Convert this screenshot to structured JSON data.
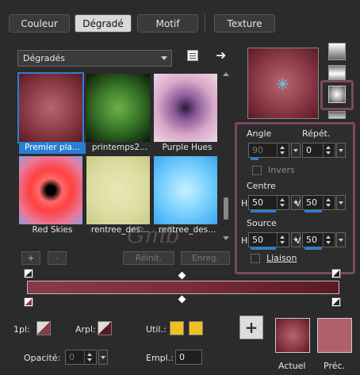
{
  "tabs": [
    {
      "label": "Couleur",
      "active": false
    },
    {
      "label": "Dégradé",
      "active": true
    },
    {
      "label": "Motif",
      "active": false
    },
    {
      "label": "Texture",
      "active": false
    }
  ],
  "gradients_dropdown": {
    "value": "Dégradés"
  },
  "thumbnails": [
    {
      "label": "Premier pla...",
      "selected": true
    },
    {
      "label": "printemps2...",
      "selected": false
    },
    {
      "label": "Purple Hues",
      "selected": false
    },
    {
      "label": "Red Skies",
      "selected": false
    },
    {
      "label": "rentree_des...",
      "selected": false
    },
    {
      "label": "rentree_des...",
      "selected": false
    }
  ],
  "buttons": {
    "add": "+",
    "remove": "-",
    "reset": "Réinit.",
    "save": "Enreg."
  },
  "options": {
    "angle_label": "Angle",
    "angle_value": "90",
    "repeat_label": "Répét.",
    "repeat_value": "0",
    "invert_label": "Invers",
    "center_label": "Centre",
    "center_h_label": "H",
    "center_h_value": "50",
    "center_v_label": "V",
    "center_v_value": "50",
    "source_label": "Source",
    "source_h_label": "H",
    "source_h_value": "50",
    "source_v_label": "V",
    "source_v_value": "50",
    "link_label": "Liaison"
  },
  "bottom": {
    "foreground_label": "1pl:",
    "background_label": "Arpl:",
    "use_label": "Util.:",
    "opacity_label": "Opacité:",
    "opacity_value": "0",
    "location_label": "Empl.:",
    "location_value": "0",
    "add_button": "+",
    "current_label": "Actuel",
    "previous_label": "Préc."
  },
  "colors": {
    "accent": "#2a7fd4",
    "highlight_border": "#7a4a5c",
    "gradient_dark": "#5a1a22",
    "gradient_mid": "#8a3a46",
    "gradient_light": "#b8656f",
    "gold": "#f0c020"
  }
}
